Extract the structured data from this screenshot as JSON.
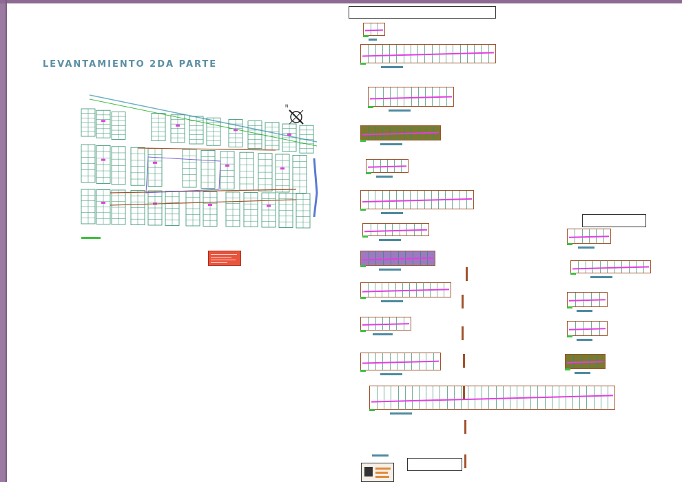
{
  "sheet": {
    "title": "LEVANTAMIENTO 2DA PARTE",
    "colors": {
      "background": "#9a7aa0",
      "paper": "#ffffff",
      "title": "#5b8fa5",
      "lots": "#2f8f6a",
      "magenta": "#e23ee2",
      "boundary": "#a0522d",
      "road": "#3fbf3f"
    }
  },
  "plan": {
    "street_top_label": "",
    "north_label": "N"
  },
  "panels": {
    "main_title_box": "",
    "right_title_box": "",
    "bottom_title_box": ""
  },
  "icons": {
    "north_arrow": "compass-rose-icon"
  }
}
